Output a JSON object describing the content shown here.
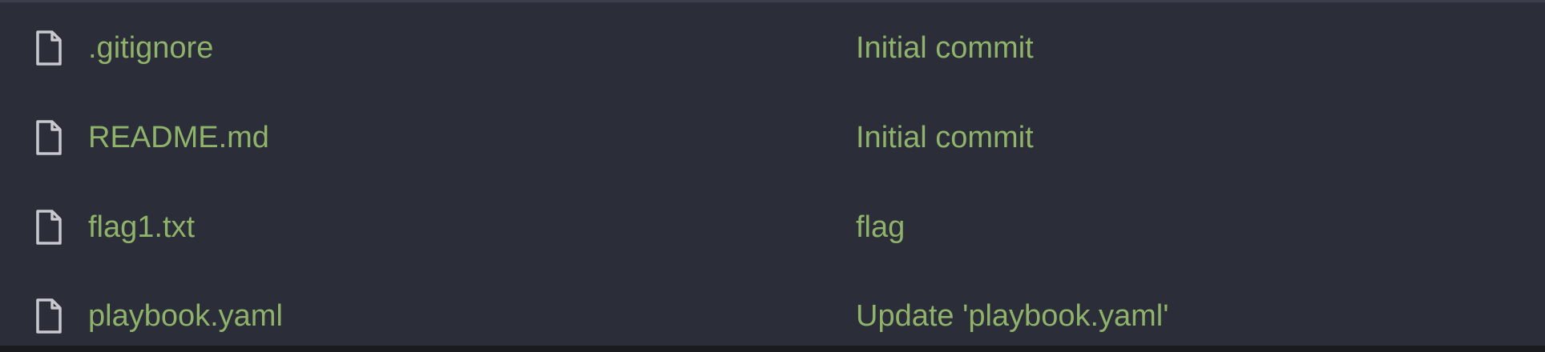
{
  "colors": {
    "background": "#2b2d38",
    "link": "#8fb36b",
    "icon": "#c7c9cf"
  },
  "files": [
    {
      "icon": "file-icon",
      "name": ".gitignore",
      "commit": "Initial commit"
    },
    {
      "icon": "file-icon",
      "name": "README.md",
      "commit": "Initial commit"
    },
    {
      "icon": "file-icon",
      "name": "flag1.txt",
      "commit": "flag"
    },
    {
      "icon": "file-icon",
      "name": "playbook.yaml",
      "commit": "Update 'playbook.yaml'"
    }
  ]
}
